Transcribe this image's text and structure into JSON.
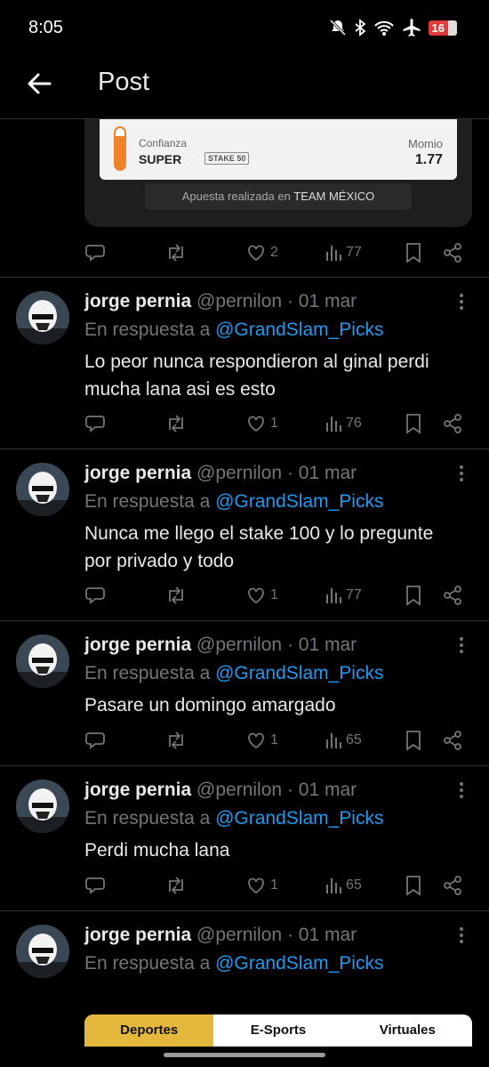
{
  "status": {
    "time": "8:05",
    "battery": "16"
  },
  "header": {
    "title": "Post"
  },
  "bet_card": {
    "confidence_label": "Confianza",
    "confidence_value": "SUPER",
    "stake": "STAKE 50",
    "momio_label": "Momio",
    "momio_value": "1.77",
    "placed_prefix": "Apuesta realizada en ",
    "placed_team": "TEAM MÉXICO"
  },
  "main_actions": {
    "likes": "2",
    "views": "77"
  },
  "replies": [
    {
      "name": "jorge pernia",
      "handle": "@pernilon",
      "date": "· 01 mar",
      "reply_prefix": "En respuesta a ",
      "reply_handle": "@GrandSlam_Picks",
      "text": "Lo peor nunca respondieron al ginal perdi mucha lana asi es esto",
      "likes": "1",
      "views": "76"
    },
    {
      "name": "jorge pernia",
      "handle": "@pernilon",
      "date": "· 01 mar",
      "reply_prefix": "En respuesta a ",
      "reply_handle": "@GrandSlam_Picks",
      "text": "Nunca me llego el stake 100 y lo pregunte por privado y todo",
      "likes": "1",
      "views": "77"
    },
    {
      "name": "jorge pernia",
      "handle": "@pernilon",
      "date": "· 01 mar",
      "reply_prefix": "En respuesta a ",
      "reply_handle": "@GrandSlam_Picks",
      "text": "Pasare un domingo amargado",
      "likes": "1",
      "views": "65"
    },
    {
      "name": "jorge pernia",
      "handle": "@pernilon",
      "date": "· 01 mar",
      "reply_prefix": "En respuesta a ",
      "reply_handle": "@GrandSlam_Picks",
      "text": "Perdi mucha lana",
      "likes": "1",
      "views": "65"
    },
    {
      "name": "jorge pernia",
      "handle": "@pernilon",
      "date": "· 01 mar",
      "reply_prefix": "En respuesta a ",
      "reply_handle": "@GrandSlam_Picks"
    }
  ],
  "tabs": [
    "Deportes",
    "E-Sports",
    "Virtuales"
  ],
  "colors": {
    "background": "#000000",
    "accent_link": "#1d9bf0",
    "muted": "#71767b",
    "tab_active": "#e4b83c"
  }
}
